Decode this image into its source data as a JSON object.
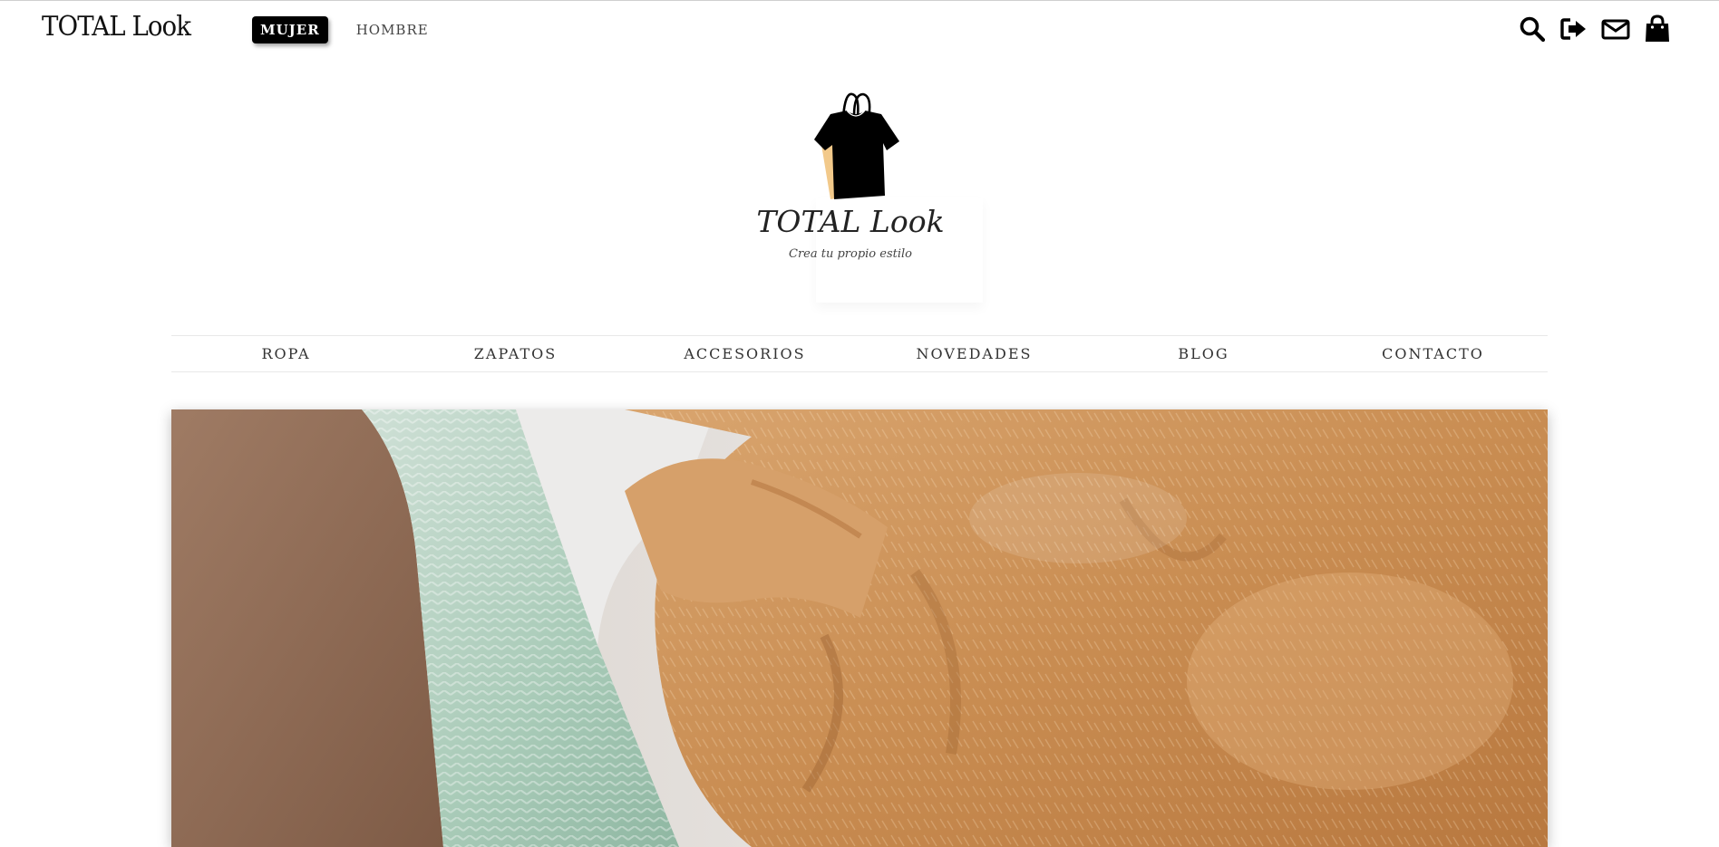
{
  "topbar": {
    "brand": "TOTAL Look",
    "tabs": [
      {
        "label": "MUJER",
        "active": true
      },
      {
        "label": "HOMBRE",
        "active": false
      }
    ],
    "icons": [
      "search-icon",
      "sign-out-icon",
      "envelope-icon",
      "shopping-bag-icon"
    ]
  },
  "logo": {
    "title": "TOTAL Look",
    "tagline": "Crea tu propio estilo"
  },
  "categories": [
    "ROPA",
    "ZAPATOS",
    "ACCESORIOS",
    "NOVEDADES",
    "BLOG",
    "CONTACTO"
  ],
  "hero": {
    "image": "knit-sweaters-photo"
  },
  "colors": {
    "accent": "#000000",
    "bag": "#f2c98a",
    "sweater_orange": "#c98d52",
    "sweater_mint": "#a9cbb8"
  }
}
